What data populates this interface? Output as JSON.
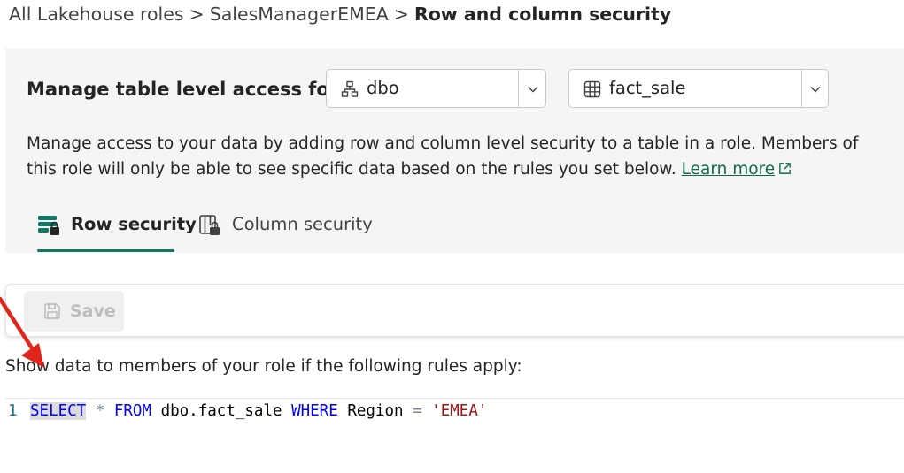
{
  "breadcrumb": {
    "items": [
      "All Lakehouse roles",
      "SalesManagerEMEA"
    ],
    "separator": ">",
    "current": "Row and column security"
  },
  "manage": {
    "label": "Manage table level access for",
    "schema_dropdown": {
      "value": "dbo",
      "icon": "schema-icon"
    },
    "table_dropdown": {
      "value": "fact_sale",
      "icon": "table-icon"
    }
  },
  "description": {
    "text": "Manage access to your data by adding row and column level security to a table in a role. Members of this role will only be able to see specific data based on the rules you set below.",
    "link_text": "Learn more"
  },
  "tabs": [
    {
      "label": "Row security",
      "icon": "row-security-icon",
      "selected": true
    },
    {
      "label": "Column security",
      "icon": "column-security-icon",
      "selected": false
    }
  ],
  "toolbar": {
    "save_label": "Save",
    "save_enabled": false
  },
  "rules_label": "Show data to members of your role if the following rules apply:",
  "editor": {
    "line_number": "1",
    "tokens": {
      "select": "SELECT",
      "star": "*",
      "from": "FROM",
      "table": "dbo.fact_sale",
      "where": "WHERE",
      "column": "Region",
      "eq": "=",
      "value": "'EMEA'"
    }
  },
  "colors": {
    "accent": "#117865",
    "link": "#0f6b4a",
    "keyword": "#0000ff",
    "string": "#a31515",
    "annotation_arrow": "#e0261b"
  }
}
